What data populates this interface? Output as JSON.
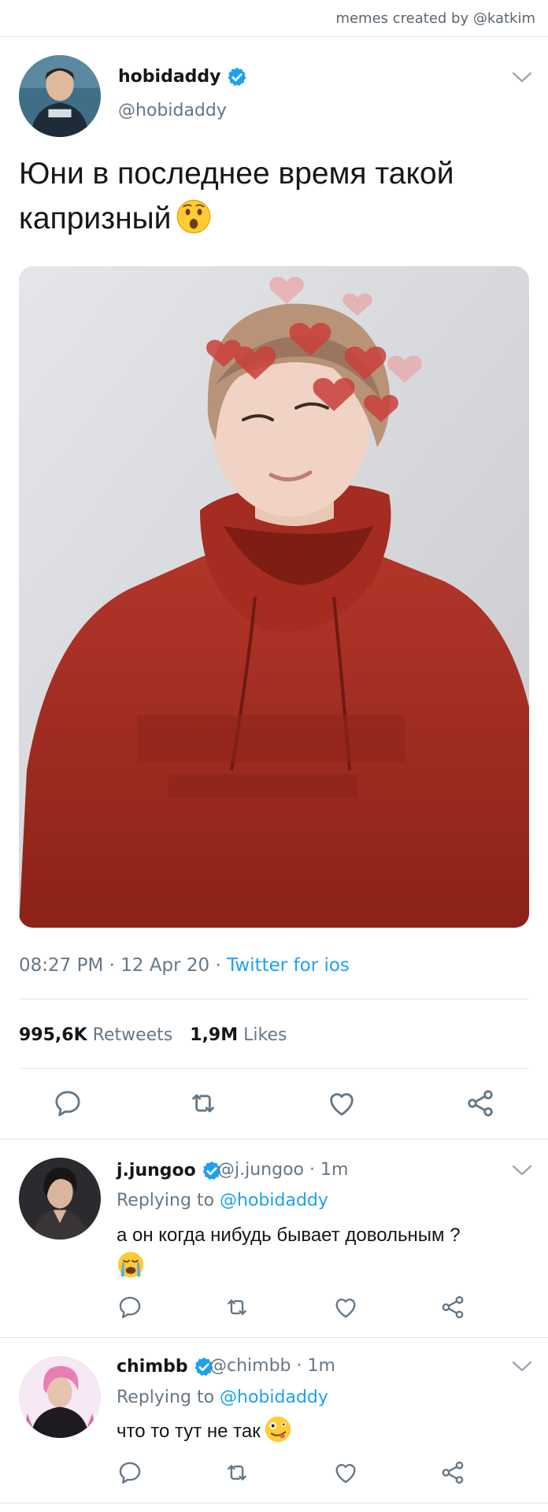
{
  "credit": "memes created by @katkim",
  "main_tweet": {
    "name": "hobidaddy",
    "handle": "@hobidaddy",
    "text": "Юни в последнее время такой капризный",
    "emoji": "astonished-face",
    "time": "08:27 PM",
    "date": "12 Apr 20",
    "source": "Twitter for ios",
    "retweets_count": "995,6K",
    "retweets_label": "Retweets",
    "likes_count": "1,9M",
    "likes_label": "Likes"
  },
  "replies": [
    {
      "name": "j.jungoo",
      "handle": "@j.jungoo",
      "time": "1m",
      "replying_label": "Replying to",
      "replying_to": "@hobidaddy",
      "text": "а он когда нибудь бывает довольным ?",
      "emoji": "crying-face"
    },
    {
      "name": "chimbb",
      "handle": "@chimbb",
      "time": "1m",
      "replying_label": "Replying to",
      "replying_to": "@hobidaddy",
      "text": "что то тут не так",
      "emoji": "zany-face"
    }
  ],
  "colors": {
    "accent": "#1da1f2",
    "secondary_text": "#657786",
    "divider": "#dfe5ea"
  }
}
